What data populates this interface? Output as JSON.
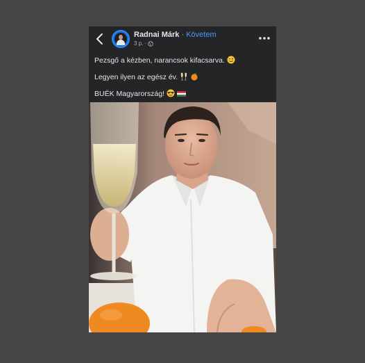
{
  "post": {
    "author": "Radnai Márk",
    "separator": "·",
    "follow_label": "Követem",
    "time": "3 p.",
    "meta_dot": "·",
    "lines": [
      "Pezsgő a kézben, narancsok kifacsarva.",
      "Legyen ilyen az egész év.",
      "BUÉK Magyarország!"
    ]
  },
  "icons": {
    "back": "chevron-left-icon",
    "more": "more-horizontal-icon",
    "privacy": "globe-icon",
    "emoji_line1": "winking-face-emoji",
    "emoji_line2": [
      "clinking-glasses-emoji",
      "tangerine-emoji"
    ],
    "emoji_line3": [
      "smiling-face-with-sunglasses-emoji",
      "hungary-flag-emoji"
    ]
  },
  "colors": {
    "background": "#454545",
    "card": "#242526",
    "text": "#e4e6eb",
    "secondary": "#b0b3b8",
    "link": "#4599ff"
  }
}
